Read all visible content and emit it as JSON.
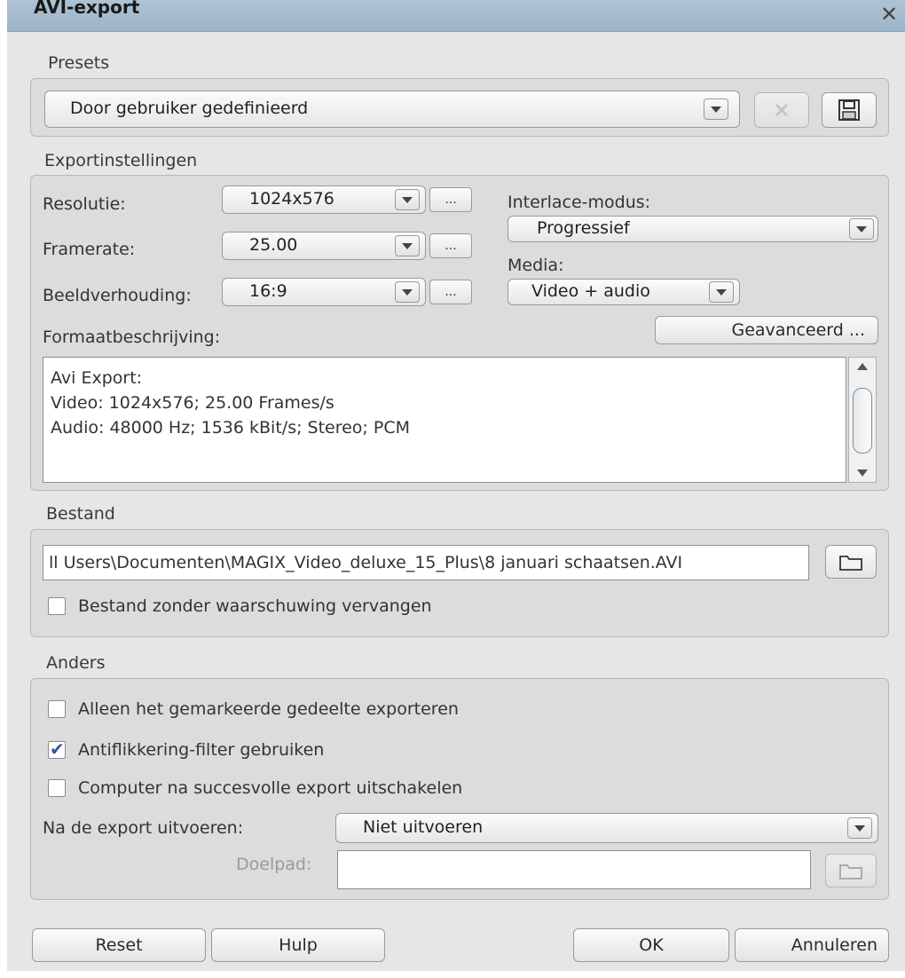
{
  "window": {
    "title": "AVI-export",
    "close_label": "✕"
  },
  "presets": {
    "section_label": "Presets",
    "selected": "Door gebruiker gedefinieerd",
    "delete_icon": "delete-preset-icon",
    "save_icon": "save-floppy-icon"
  },
  "export": {
    "section_label": "Exportinstellingen",
    "resolution_label": "Resolutie:",
    "resolution_value": "1024x576",
    "framerate_label": "Framerate:",
    "framerate_value": "25.00",
    "aspect_label": "Beeldverhouding:",
    "aspect_value": "16:9",
    "dots_label": "...",
    "interlace_label": "Interlace-modus:",
    "interlace_value": "Progressief",
    "media_label": "Media:",
    "media_value": "Video + audio",
    "advanced_label": "Geavanceerd ...",
    "format_label": "Formaatbeschrijving:",
    "format_lines": [
      "Avi Export:",
      "Video: 1024x576; 25.00 Frames/s",
      "Audio: 48000 Hz; 1536 kBit/s; Stereo; PCM"
    ]
  },
  "file": {
    "section_label": "Bestand",
    "path": "ll Users\\Documenten\\MAGIX_Video_deluxe_15_Plus\\8 januari schaatsen.AVI",
    "overwrite_label": "Bestand zonder waarschuwing vervangen",
    "overwrite_checked": false
  },
  "other": {
    "section_label": "Anders",
    "only_selected_label": "Alleen het gemarkeerde gedeelte exporteren",
    "only_selected_checked": false,
    "antiflicker_label": "Antiflikkering-filter gebruiken",
    "antiflicker_checked": true,
    "shutdown_label": "Computer na succesvolle export uitschakelen",
    "shutdown_checked": false,
    "after_export_label": "Na de export uitvoeren:",
    "after_export_value": "Niet uitvoeren",
    "target_label": "Doelpad:",
    "target_value": ""
  },
  "buttons": {
    "reset": "Reset",
    "help": "Hulp",
    "ok": "OK",
    "cancel": "Annuleren"
  }
}
